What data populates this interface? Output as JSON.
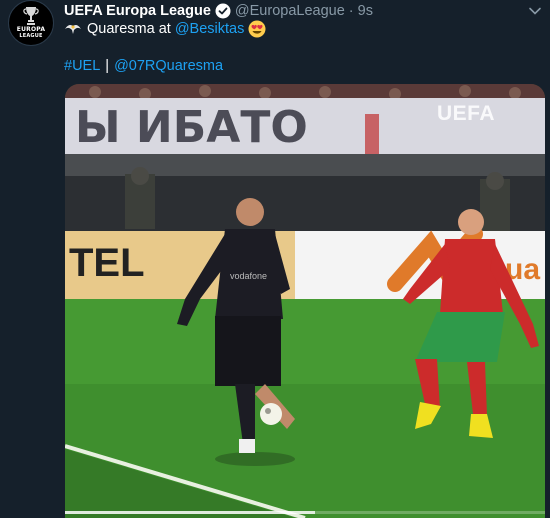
{
  "account": {
    "display_name": "UEFA Europa League",
    "handle": "@EuropaLeague",
    "time": "9s",
    "avatar_icon": "europa-league-trophy-icon",
    "avatar_text_1": "EUROPA",
    "avatar_text_2": "LEAGUE"
  },
  "tweet": {
    "text_before": "Quaresma at",
    "mention": "@Besiktas",
    "hashtag": "#UEL",
    "separator": "|",
    "mention2": "@07RQuaresma"
  },
  "media": {
    "watermark": "UEFA",
    "progress": 0.52
  },
  "colors": {
    "background": "#15202b",
    "secondary_text": "#8899a6",
    "link": "#1da1f2"
  }
}
